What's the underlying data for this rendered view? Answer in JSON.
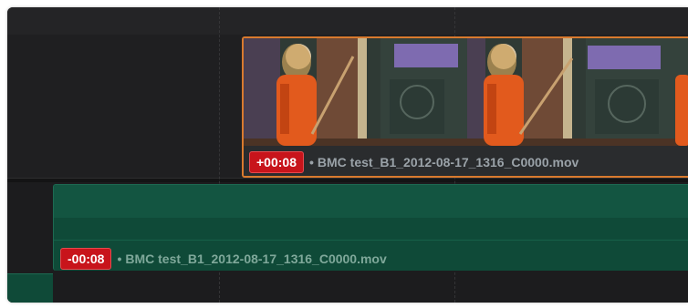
{
  "timeline": {
    "video_clip": {
      "offset_badge": "+00:08",
      "name": "BMC test_B1_2012-08-17_1316_C0000.mov",
      "thumbnail_icon": "video-frame-thumbnail",
      "border_color": "#d97a2e"
    },
    "audio_clip": {
      "offset_badge": "-00:08",
      "name": "BMC test_B1_2012-08-17_1316_C0000.mov",
      "color": "#0f4a38"
    },
    "badge_color": "#c8141b",
    "bullet": "•"
  }
}
